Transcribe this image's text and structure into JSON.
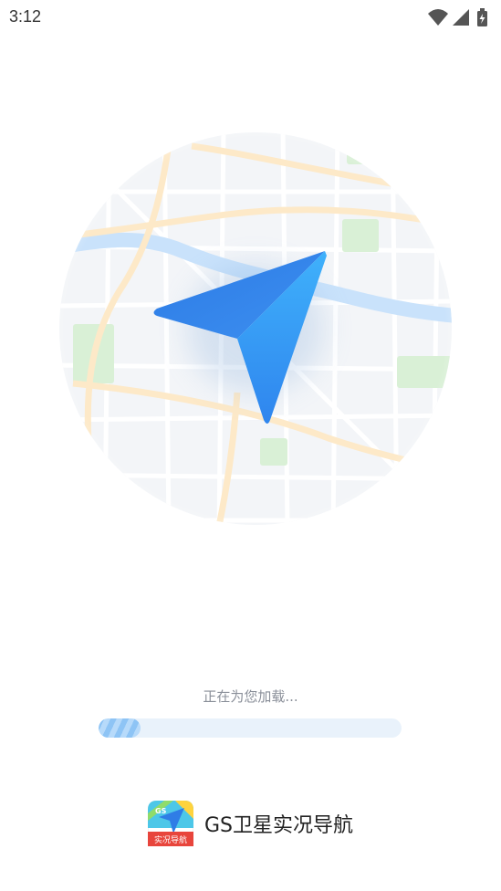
{
  "status_bar": {
    "time": "3:12"
  },
  "loading": {
    "text": "正在为您加载...",
    "progress": 0.14
  },
  "brand": {
    "app_name": "GS卫星实况导航",
    "icon_badge": "GS",
    "icon_label": "实况导航"
  },
  "colors": {
    "accent": "#2f8af5",
    "progress_track": "#e9f2fb",
    "progress_fill": "#8ec4f5"
  },
  "icons": [
    "wifi-icon",
    "signal-icon",
    "battery-charging-icon",
    "navigation-arrow-icon",
    "map-illustration",
    "app-icon"
  ]
}
